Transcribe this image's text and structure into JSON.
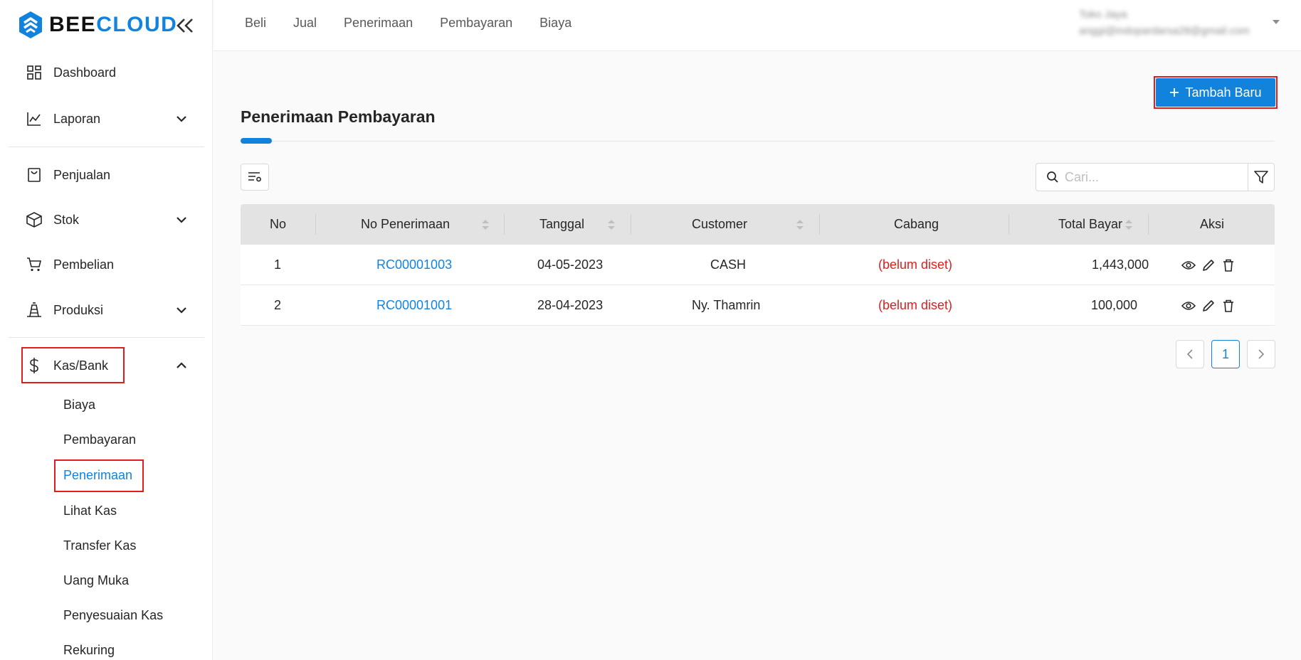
{
  "brand": {
    "part1": "BEE",
    "part2": "CLOUD"
  },
  "sidebar": {
    "items": [
      {
        "label": "Dashboard"
      },
      {
        "label": "Laporan"
      },
      {
        "label": "Penjualan"
      },
      {
        "label": "Stok"
      },
      {
        "label": "Pembelian"
      },
      {
        "label": "Produksi"
      },
      {
        "label": "Kas/Bank"
      }
    ],
    "submenu": [
      "Biaya",
      "Pembayaran",
      "Penerimaan",
      "Lihat Kas",
      "Transfer Kas",
      "Uang Muka",
      "Penyesuaian Kas",
      "Rekuring"
    ]
  },
  "topnav": [
    "Beli",
    "Jual",
    "Penerimaan",
    "Pembayaran",
    "Biaya"
  ],
  "user": {
    "name": "Toko Jaya",
    "email": "anggi@indopardarsa28@gmail.com"
  },
  "page": {
    "title": "Penerimaan Pembayaran",
    "add_label": "Tambah Baru",
    "search_placeholder": "Cari..."
  },
  "table": {
    "headers": [
      "No",
      "No Penerimaan",
      "Tanggal",
      "Customer",
      "Cabang",
      "Total Bayar",
      "Aksi"
    ],
    "rows": [
      {
        "no": "1",
        "id": "RC00001003",
        "date": "04-05-2023",
        "customer": "CASH",
        "branch": "(belum diset)",
        "total": "1,443,000"
      },
      {
        "no": "2",
        "id": "RC00001001",
        "date": "28-04-2023",
        "customer": "Ny. Thamrin",
        "branch": "(belum diset)",
        "total": "100,000"
      }
    ]
  },
  "pagination": {
    "current": "1"
  },
  "colors": {
    "accent": "#1283dd",
    "highlight": "#e01d1d",
    "warning": "#e01d1d"
  }
}
